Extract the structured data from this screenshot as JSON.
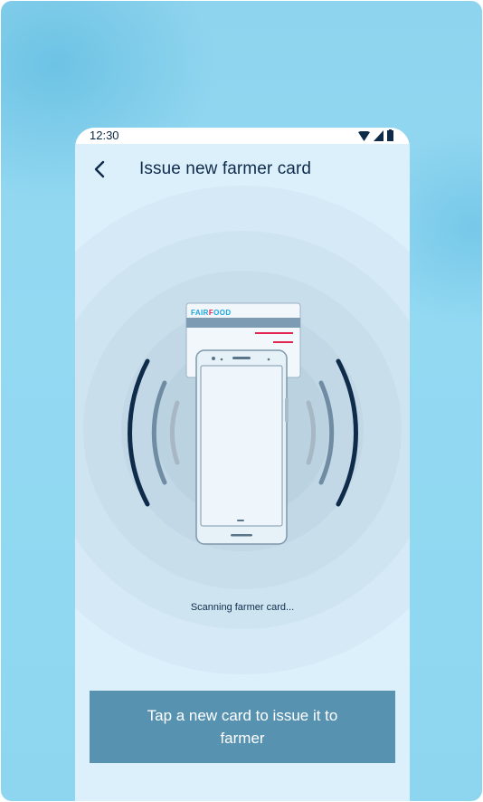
{
  "status_bar": {
    "time": "12:30",
    "icons": [
      "wifi-icon",
      "signal-icon",
      "battery-icon"
    ]
  },
  "header": {
    "back_icon": "chevron-left-icon",
    "title": "Issue new farmer card"
  },
  "illustration": {
    "card_brand_prefix": "FAIR",
    "card_brand_suffix": "OOD",
    "card_brand_highlight": "F",
    "colors": {
      "brand_blue": "#1aa6e4",
      "brand_red": "#e0254f",
      "wave_dark": "#0e2c4a",
      "wave_mid": "#6f8ca3",
      "wave_light": "#a7b7c4"
    }
  },
  "scan_status": "Scanning farmer card...",
  "instruction": "Tap a new card to issue it to farmer",
  "theme": {
    "background": "#8fd4ee",
    "screen": "#dcf0fb",
    "button": "#5892b1"
  }
}
